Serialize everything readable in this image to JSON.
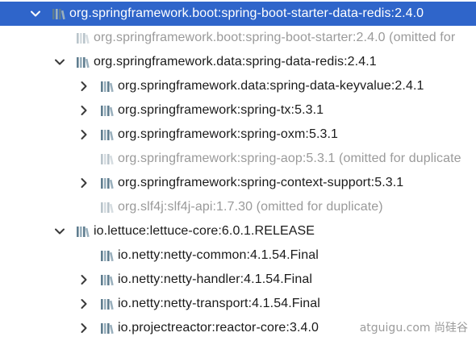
{
  "tree": {
    "rows": [
      {
        "label": "org.springframework.boot:spring-boot-starter-data-redis:2.4.0",
        "expander": "expanded",
        "dimmed": false,
        "selected": true
      },
      {
        "label": "org.springframework.boot:spring-boot-starter:2.4.0 (omitted for",
        "expander": "none",
        "dimmed": true,
        "selected": false
      },
      {
        "label": "org.springframework.data:spring-data-redis:2.4.1",
        "expander": "expanded",
        "dimmed": false,
        "selected": false
      },
      {
        "label": "org.springframework.data:spring-data-keyvalue:2.4.1",
        "expander": "collapsed",
        "dimmed": false,
        "selected": false
      },
      {
        "label": "org.springframework:spring-tx:5.3.1",
        "expander": "collapsed",
        "dimmed": false,
        "selected": false
      },
      {
        "label": "org.springframework:spring-oxm:5.3.1",
        "expander": "collapsed",
        "dimmed": false,
        "selected": false
      },
      {
        "label": "org.springframework:spring-aop:5.3.1 (omitted for duplicate",
        "expander": "none",
        "dimmed": true,
        "selected": false
      },
      {
        "label": "org.springframework:spring-context-support:5.3.1",
        "expander": "collapsed",
        "dimmed": false,
        "selected": false
      },
      {
        "label": "org.slf4j:slf4j-api:1.7.30 (omitted for duplicate)",
        "expander": "none",
        "dimmed": true,
        "selected": false
      },
      {
        "label": "io.lettuce:lettuce-core:6.0.1.RELEASE",
        "expander": "expanded",
        "dimmed": false,
        "selected": false
      },
      {
        "label": "io.netty:netty-common:4.1.54.Final",
        "expander": "none",
        "dimmed": false,
        "selected": false
      },
      {
        "label": "io.netty:netty-handler:4.1.54.Final",
        "expander": "collapsed",
        "dimmed": false,
        "selected": false
      },
      {
        "label": "io.netty:netty-transport:4.1.54.Final",
        "expander": "collapsed",
        "dimmed": false,
        "selected": false
      },
      {
        "label": "io.projectreactor:reactor-core:3.4.0",
        "expander": "collapsed",
        "dimmed": false,
        "selected": false
      }
    ]
  },
  "icons": {
    "library": "library-icon",
    "expanded": "chevron-down-icon",
    "collapsed": "chevron-right-icon"
  },
  "watermark": "atguigu.com 尚硅谷",
  "colors": {
    "selection": "#2f65ca",
    "dimmed_text": "#9a9a9a",
    "text": "#1a1a1a",
    "icon_bar_dark": "#5f7d8f",
    "icon_bar_light": "#9ab0bd"
  }
}
